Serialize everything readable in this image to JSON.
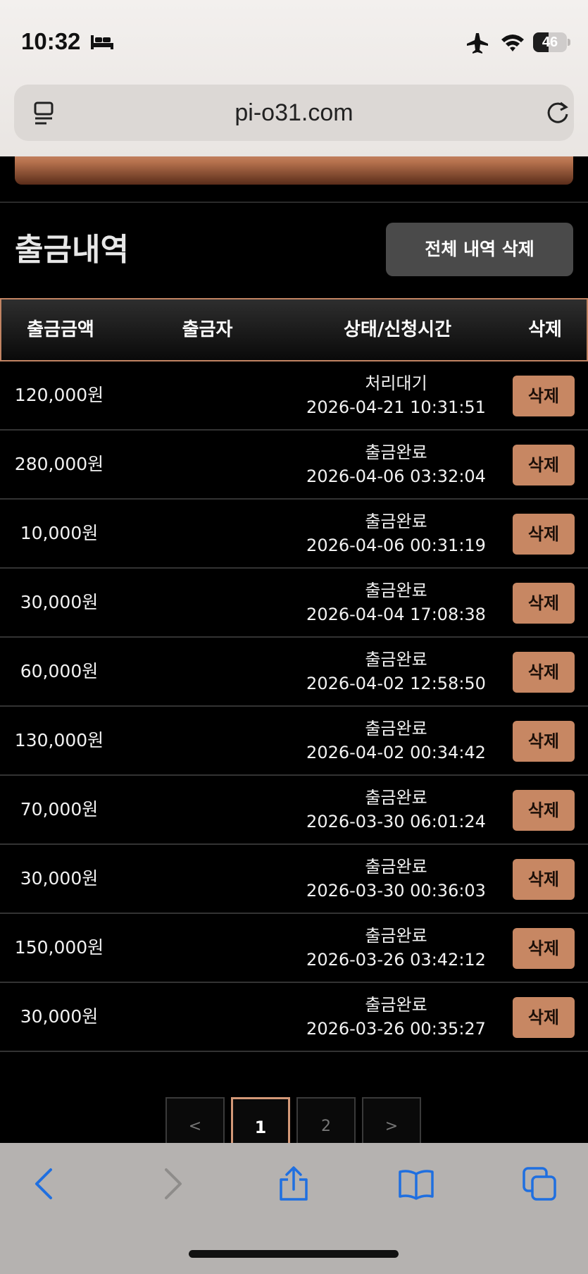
{
  "status_bar": {
    "time": "10:32",
    "battery": "46",
    "battery_level": 0.46
  },
  "browser": {
    "url": "pi-o31.com"
  },
  "content": {
    "peek_button_label": "",
    "section_title": "출금내역",
    "delete_all_label": "전체 내역 삭제",
    "table": {
      "headers": [
        "출금금액",
        "출금자",
        "상태/신청시간",
        "삭제"
      ],
      "rows": [
        {
          "amount": "120,000원",
          "status": "처리대기",
          "time": "2026-04-21 10:31:51",
          "delete": "삭제"
        },
        {
          "amount": "280,000원",
          "status": "출금완료",
          "time": "2026-04-06 03:32:04",
          "delete": "삭제"
        },
        {
          "amount": "10,000원",
          "status": "출금완료",
          "time": "2026-04-06 00:31:19",
          "delete": "삭제"
        },
        {
          "amount": "30,000원",
          "status": "출금완료",
          "time": "2026-04-04 17:08:38",
          "delete": "삭제"
        },
        {
          "amount": "60,000원",
          "status": "출금완료",
          "time": "2026-04-02 12:58:50",
          "delete": "삭제"
        },
        {
          "amount": "130,000원",
          "status": "출금완료",
          "time": "2026-04-02 00:34:42",
          "delete": "삭제"
        },
        {
          "amount": "70,000원",
          "status": "출금완료",
          "time": "2026-03-30 06:01:24",
          "delete": "삭제"
        },
        {
          "amount": "30,000원",
          "status": "출금완료",
          "time": "2026-03-30 00:36:03",
          "delete": "삭제"
        },
        {
          "amount": "150,000원",
          "status": "출금완료",
          "time": "2026-03-26 03:42:12",
          "delete": "삭제"
        },
        {
          "amount": "30,000원",
          "status": "출금완료",
          "time": "2026-03-26 00:35:27",
          "delete": "삭제"
        }
      ]
    },
    "pagination": {
      "prev": "<",
      "pages": [
        "1",
        "2"
      ],
      "current": "1",
      "next": ">"
    }
  },
  "colors": {
    "accent": "#c78763",
    "header_border": "#c28463",
    "background": "#000000"
  },
  "toolbar_icons": [
    "back-icon",
    "forward-icon",
    "share-icon",
    "bookmarks-icon",
    "tabs-icon"
  ]
}
